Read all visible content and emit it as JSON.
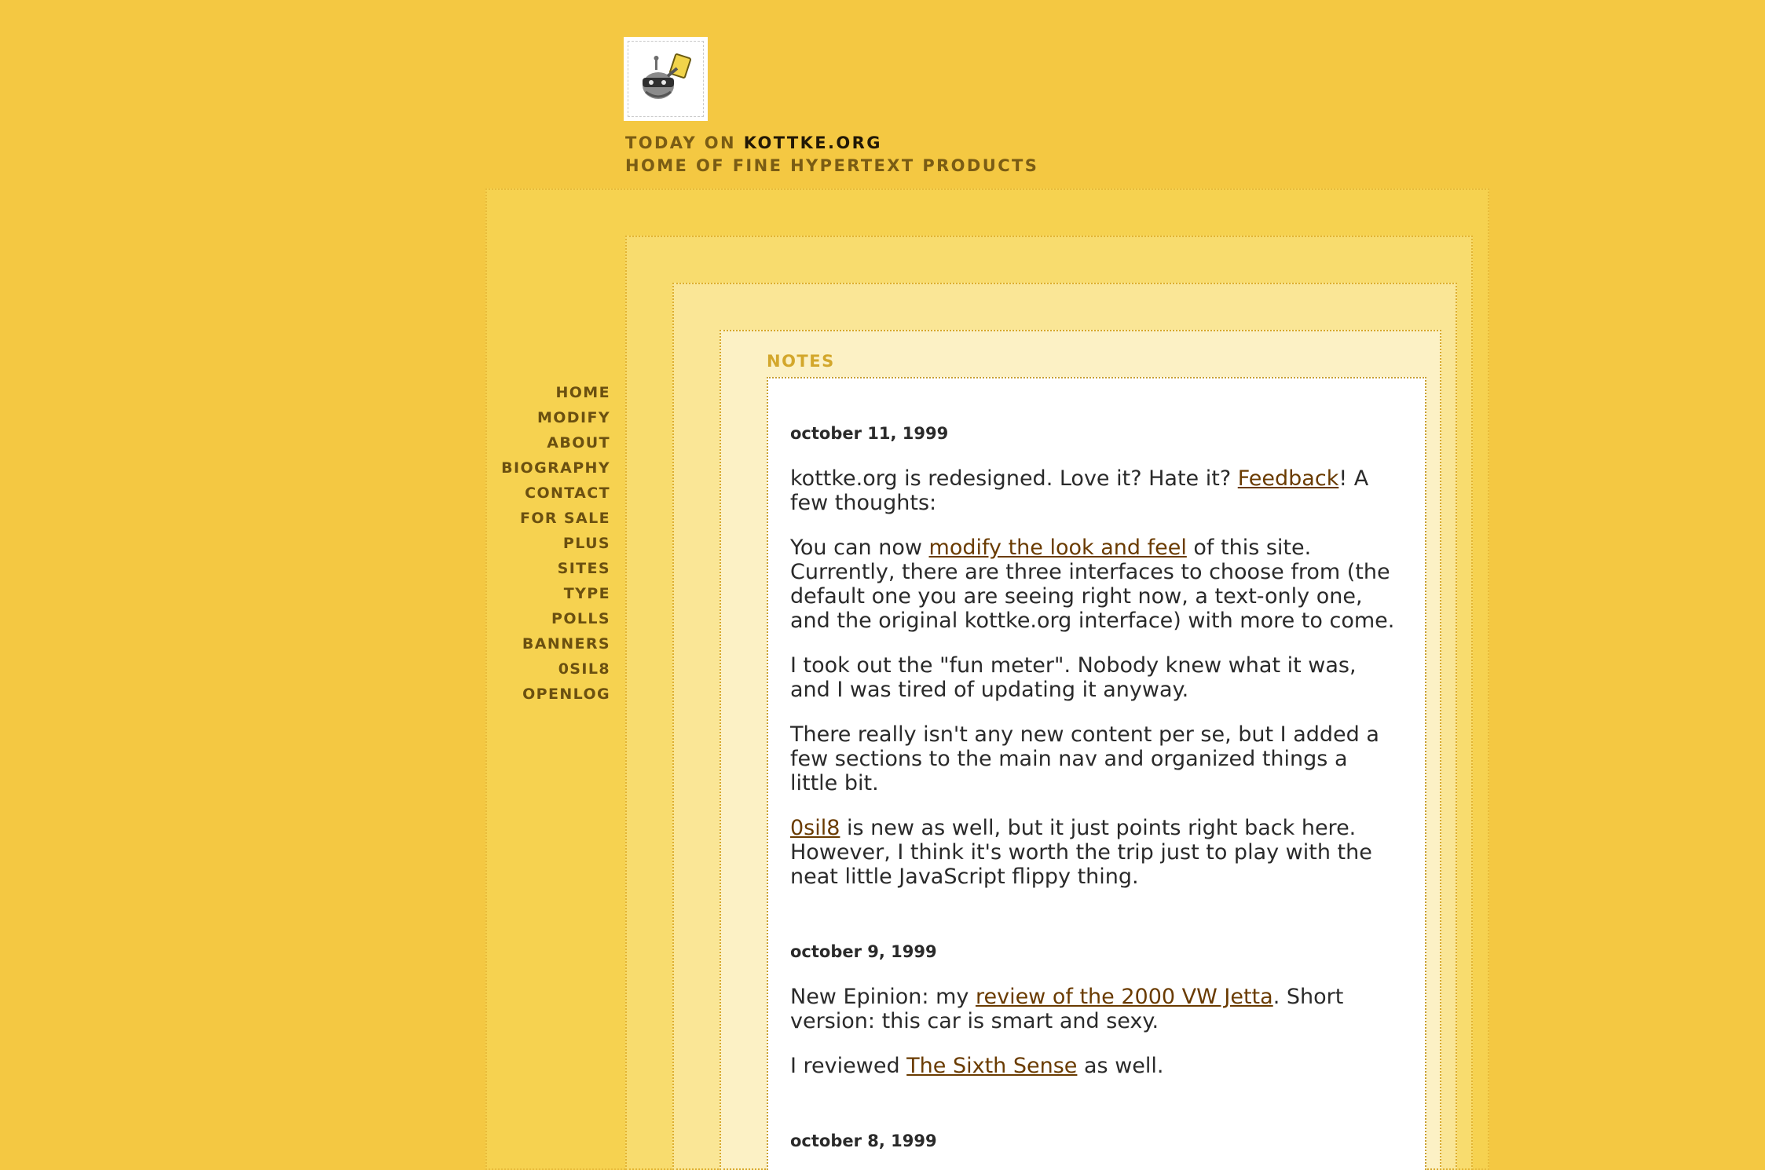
{
  "header": {
    "logo_icon": "robot-stamp-icon",
    "today_prefix": "TODAY ON ",
    "site_name": "KOTTKE.ORG",
    "tagline": "HOME OF FINE HYPERTEXT PRODUCTS"
  },
  "nav": {
    "items": [
      "HOME",
      "MODIFY",
      "ABOUT",
      "BIOGRAPHY",
      "CONTACT",
      "FOR SALE",
      "PLUS",
      "SITES",
      "TYPE",
      "POLLS",
      "BANNERS",
      "0SIL8",
      "OPENLOG"
    ]
  },
  "notes": {
    "title": "NOTES",
    "entries": [
      {
        "date": "october 11, 1999",
        "p1_a": "kottke.org is redesigned. Love it? Hate it? ",
        "p1_link": "Feedback",
        "p1_b": "! A few thoughts:",
        "p2_a": "You can now ",
        "p2_link": "modify the look and feel",
        "p2_b": " of this site. Currently, there are three interfaces to choose from (the default one you are seeing right now, a text-only one, and the original kottke.org interface) with more to come.",
        "p3": "I took out the \"fun meter\". Nobody knew what it was, and I was tired of updating it anyway.",
        "p4": "There really isn't any new content per se, but I added a few sections to the main nav and organized things a little bit.",
        "p5_link": "0sil8",
        "p5_b": " is new as well, but it just points right back here. However, I think it's worth the trip just to play with the neat little JavaScript flippy thing."
      },
      {
        "date": "october 9, 1999",
        "p1_a": "New Epinion: my ",
        "p1_link": "review of the 2000 VW Jetta",
        "p1_b": ". Short version: this car is smart and sexy.",
        "p2_a": "I reviewed ",
        "p2_link": "The Sixth Sense",
        "p2_b": " as well."
      },
      {
        "date": "october 8, 1999"
      }
    ]
  },
  "colors": {
    "background": "#f4c842",
    "link": "#6a3b00",
    "nav_text": "#6b5010"
  }
}
